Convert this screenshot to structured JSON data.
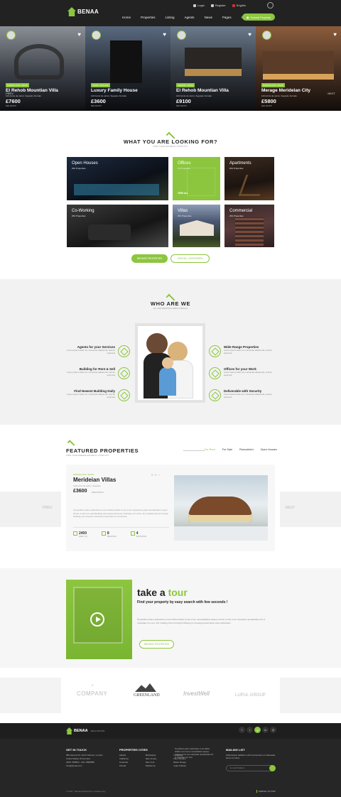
{
  "brand": {
    "name": "BENAA",
    "tagline": "REAL ESTATE",
    "accent": "#8cc63f"
  },
  "topbar": {
    "login": "Login",
    "register": "Register",
    "language": "English"
  },
  "menu": [
    "Home",
    "Properties",
    "Listing",
    "Agents",
    "News",
    "Pages",
    "Contact"
  ],
  "submit_label": "Submit Property",
  "hero": {
    "prev": "PREV",
    "next": "NEXT",
    "cards": [
      {
        "loc": "BARCELONA, SPAIN",
        "title": "El Rehob Mountian Villa",
        "addr": "146 Acnts de carrer, Segredo Forraks",
        "price": "£7600",
        "sub": "PER MONTH"
      },
      {
        "loc": "PARIS, FRANCE",
        "title": "Luxury Family House",
        "addr": "146 Acnts de carrer, Segredo Forraks",
        "price": "£3600",
        "sub": "PER MONTH"
      },
      {
        "loc": "MADRID, SPAIN",
        "title": "El Rehob Mountian Villa",
        "addr": "146 Acnts de carrer, Segredo Forraks",
        "price": "£9100",
        "sub": "PER MONTH"
      },
      {
        "loc": "BARCELONA, SPAIN",
        "title": "Merage Meridelan City",
        "addr": "146 Acnts de carrer, Segredo Forraks",
        "price": "£5800",
        "sub": "PER MONTH"
      }
    ]
  },
  "looking": {
    "title": "WHAT YOU ARE LOOKING FOR?",
    "subtitle": "FIND YOUR HOUSE IN YOUR CITY",
    "tiles": [
      {
        "name": "Open Houses",
        "count": "254 Properties"
      },
      {
        "name": "Offices",
        "count": "15 Properties",
        "link": "VIEW ALL"
      },
      {
        "name": "Apartments",
        "count": "254 Properties"
      },
      {
        "name": "Co-Working",
        "count": "254 Properties"
      },
      {
        "name": "Villas",
        "count": "254 Properties"
      },
      {
        "name": "Commercial",
        "count": "254 Properties"
      }
    ],
    "btn_browse": "BROWSE PROPERTIES",
    "btn_all": "VIEW ALL CATEGORIES"
  },
  "who": {
    "title": "WHO ARE WE",
    "subtitle": "ALL INFORMATION ABOUT BENAA",
    "left": [
      {
        "title": "Agents for your Services",
        "desc": "Lorem ipsum dolor sit, consectet adipisi elit, sed do eiusmod"
      },
      {
        "title": "Building for Rent & Sell",
        "desc": "Lorem ipsum dolor sit, consectet adipisi elit, sed do eiusmod"
      },
      {
        "title": "Find Newest Building Daily",
        "desc": "Lorem ipsum dolor sit, consectet adipisi elit, sed do eiusmod"
      }
    ],
    "right": [
      {
        "title": "Wide Range Properties",
        "desc": "Lorem ipsum dolor sit, consectet adipisi elit, sed do eiusmod"
      },
      {
        "title": "Offices for your Work",
        "desc": "Lorem ipsum dolor sit, consectet adipisi elit, sed do eiusmod"
      },
      {
        "title": "Deliverable with Security",
        "desc": "Lorem ipsum dolor sit, consectet adipisi elit, sed do eiusmod"
      }
    ]
  },
  "featured": {
    "title": "FEATURED PROPERTIES",
    "subtitle": "FIND YOUR DREAM HOUSE IN YOUR CITY",
    "tabs": [
      "For Rent",
      "For Sale",
      "Remodeled",
      "Open Houses"
    ],
    "loc": "BARCELONA, SPAIN",
    "name": "Merideian Villas",
    "addr": "146 Acnts de carrer, Segredo",
    "price": "£3600",
    "price_sub": "PER MONTH",
    "desc": "Tempofbus autem quibusdam et aut officiis debitis is aut rerum properties polls recreatidvilus nropes laonet ut ulisi nec opla Building terecuatus polt done molestiae non ratos. No Creating future through building pno propertie fodeiana preservation on business.",
    "stats": [
      {
        "v": "2400",
        "l": "AREA, SQ"
      },
      {
        "v": "8",
        "l": "BEDROOM"
      },
      {
        "v": "4",
        "l": "BATHROOM"
      }
    ],
    "prev": "PREV",
    "next": "NEXT"
  },
  "tour": {
    "title1": "take a ",
    "title2": "tour",
    "subtitle": "Find your property by easy search with few seconds !",
    "desc": "Tempofbus autem quibusdam et aut officiis debitis is aut rerum necessitatibus saepes evenet ut sine sunt voluptates repudiandae sint et molestiae non recu. Etr Creating future through building pno Creating preservation sites quibusdam.",
    "btn": "BROWSE PROPERTIES"
  },
  "partners": [
    "COMPANY",
    "GREENLAND",
    "InvestWell",
    "LUPUL GROUP"
  ],
  "footer": {
    "contact_title": "GET IN TOUCH",
    "contact": [
      "380 Harvest St, North Subrect, London",
      "United States Of America",
      "2655- 558552 - 254- 8589858",
      "info@benaa.com"
    ],
    "cities_title": "PROPERTIES CITIES",
    "cities": [
      [
        "Alaska",
        "California",
        "Colorado",
        "Florida"
      ],
      [
        "Mississippi",
        "New Jersey",
        "New York",
        "Oklahoma"
      ],
      [
        "Louisiana",
        "New Orleans",
        "Baton Rouge",
        "Lake Charles"
      ]
    ],
    "about": "Tempofbus autem quibusdam et aut officiis debitis is aut rerum necessitatibus saepes evenet ut sine sunt voluptates repudiandae sint et molestiae non recu.",
    "mail_title": "MAILING LIST",
    "mail_text": "Pellentesque habitant morbi tenentumans et malesuada fames ac turpis",
    "mail_placeholder": "E-mail Address",
    "copyright": "© 2017 - Benaa Powered by Creative any",
    "scroll": "SCROLL TO TOP"
  }
}
